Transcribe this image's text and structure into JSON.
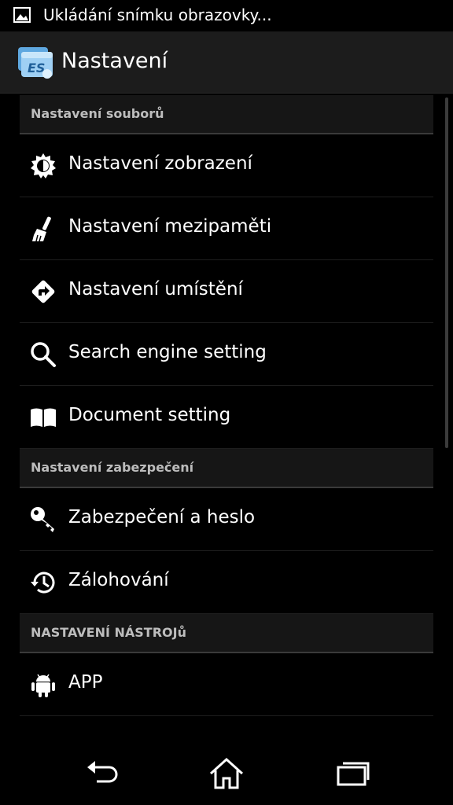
{
  "status_bar": {
    "notification_text": "Ukládání snímku obrazovky..."
  },
  "action_bar": {
    "title": "Nastavení"
  },
  "sections": [
    {
      "header": "Nastavení souborů",
      "items": [
        {
          "label": "Nastavení zobrazení",
          "icon": "display-settings-icon"
        },
        {
          "label": "Nastavení mezipaměti",
          "icon": "broom-icon"
        },
        {
          "label": "Nastavení umístění",
          "icon": "directions-icon"
        },
        {
          "label": "Search engine setting",
          "icon": "search-icon"
        },
        {
          "label": "Document setting",
          "icon": "book-icon"
        }
      ]
    },
    {
      "header": "Nastavení zabezpečení",
      "items": [
        {
          "label": "Zabezpečení a heslo",
          "icon": "key-icon"
        },
        {
          "label": "Zálohování",
          "icon": "history-icon"
        }
      ]
    },
    {
      "header": "NASTAVENÍ NÁSTROJů",
      "items": [
        {
          "label": "APP",
          "icon": "android-icon"
        }
      ]
    }
  ],
  "colors": {
    "background": "#000000",
    "action_bar": "#1c1c1c",
    "section_header": "#161616",
    "text": "#ffffff"
  }
}
